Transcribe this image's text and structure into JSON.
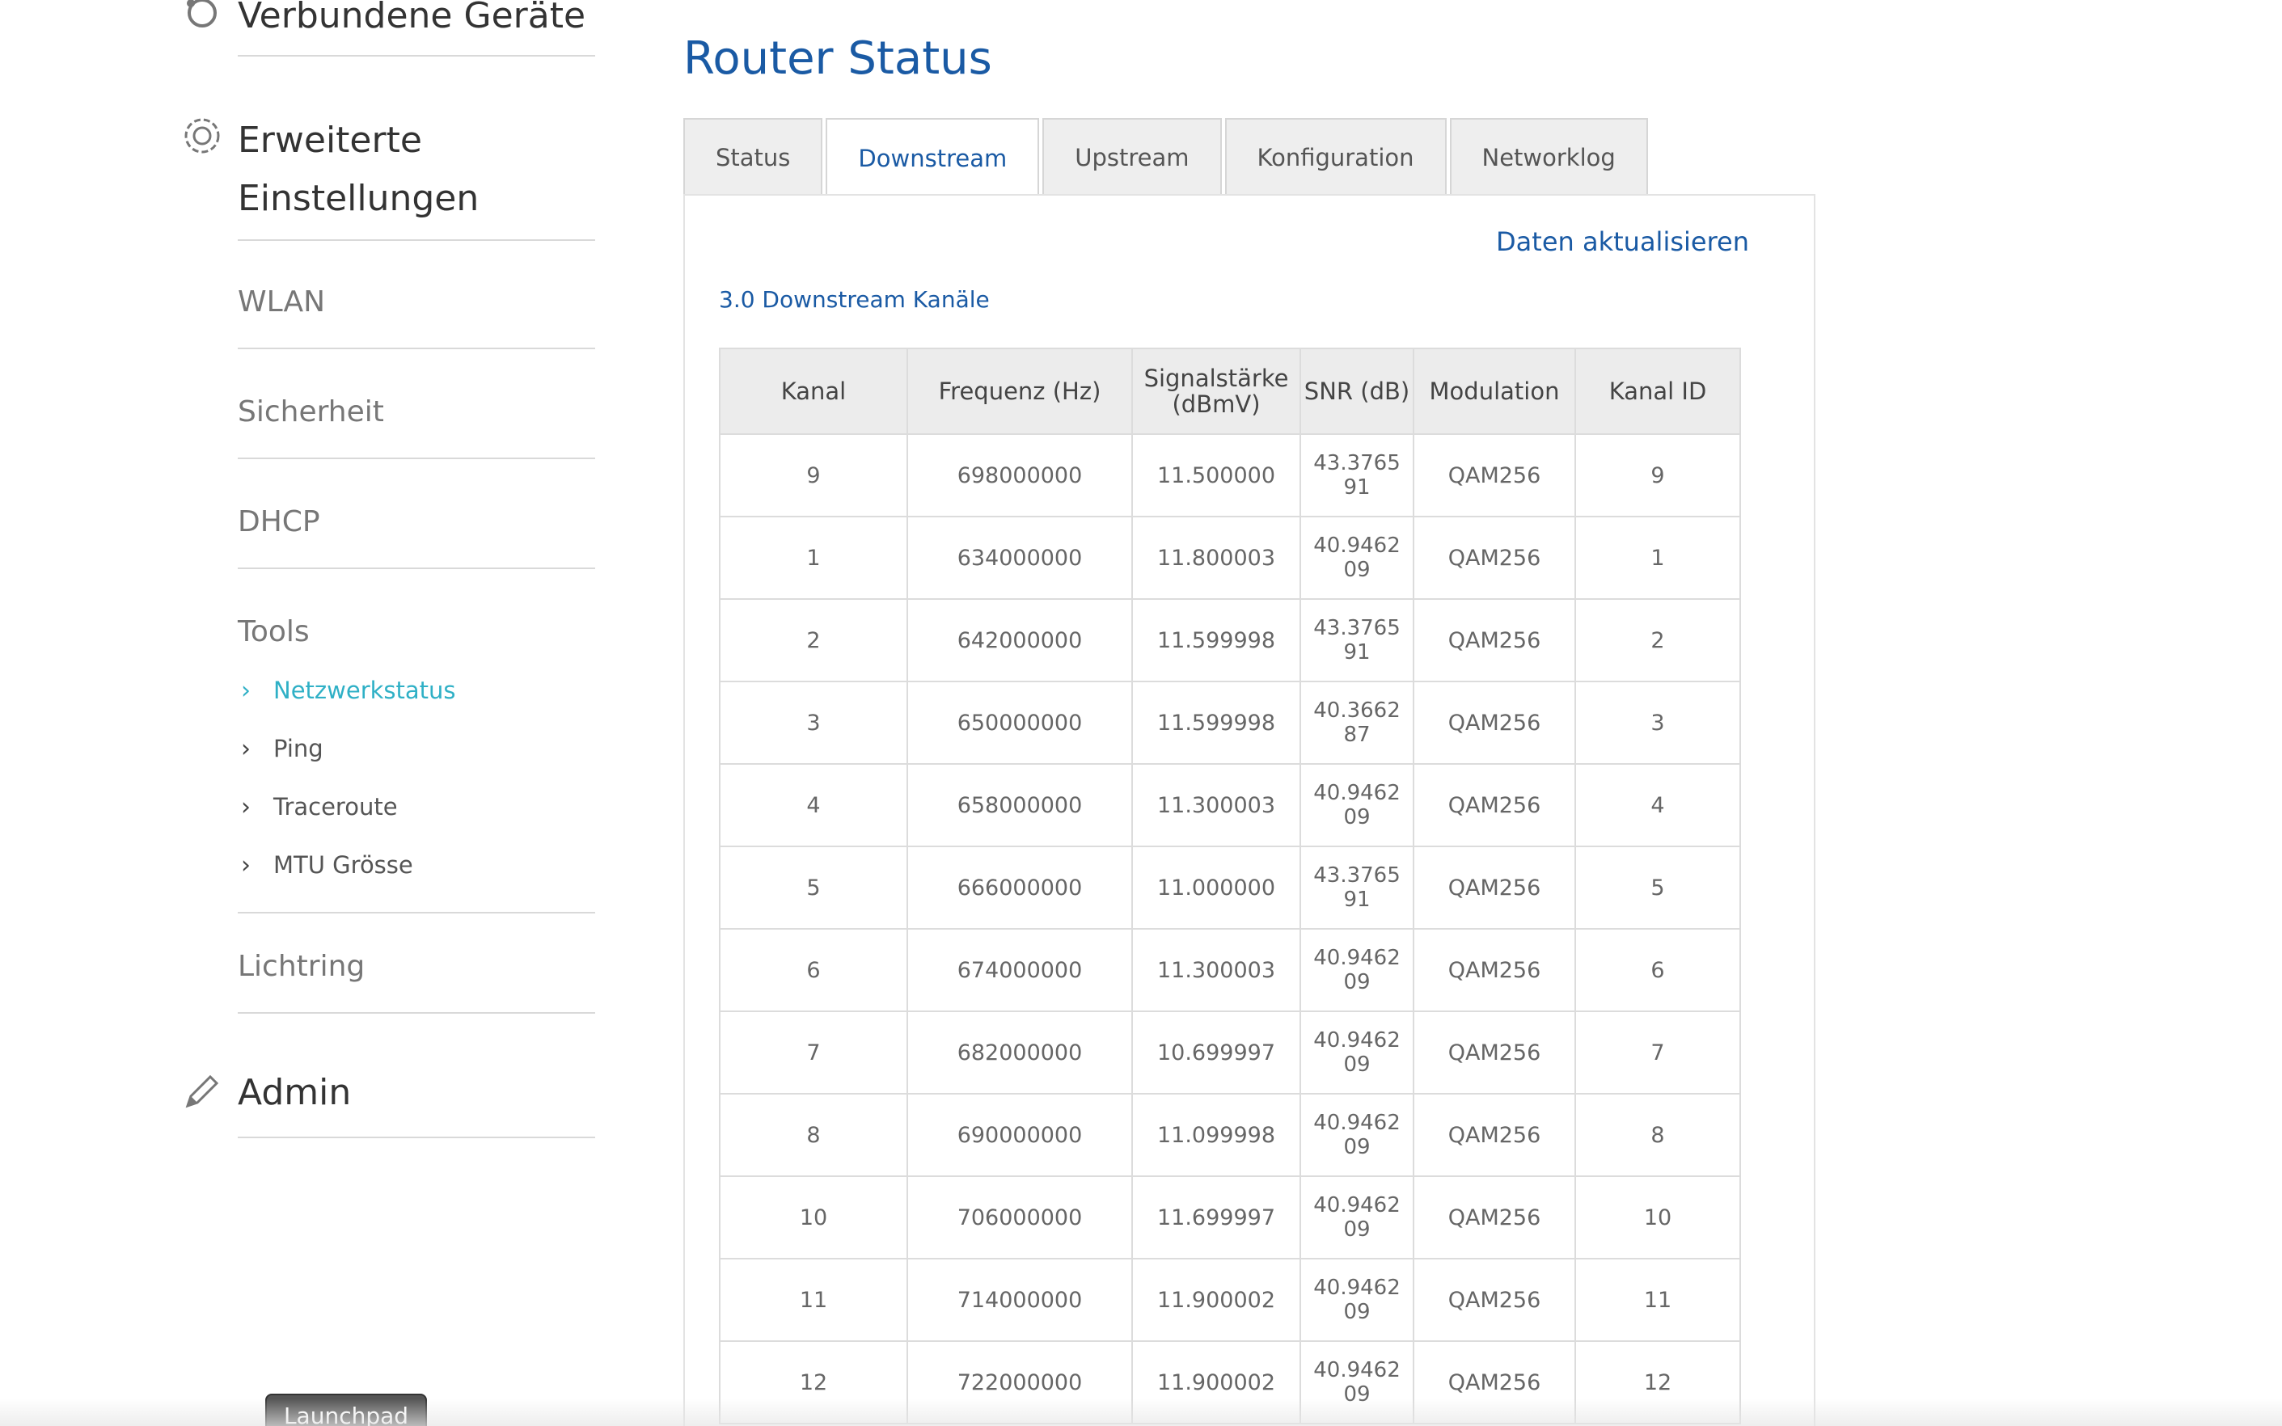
{
  "sidebar": {
    "connected_devices": "Verbundene Geräte",
    "advanced_line1": "Erweiterte",
    "advanced_line2": "Einstellungen",
    "items": [
      "WLAN",
      "Sicherheit",
      "DHCP",
      "Tools"
    ],
    "tools_sub": [
      "Netzwerkstatus",
      "Ping",
      "Traceroute",
      "MTU Grösse"
    ],
    "lichtring": "Lichtring",
    "admin": "Admin"
  },
  "main": {
    "title": "Router Status",
    "tabs": [
      "Status",
      "Downstream",
      "Upstream",
      "Konfiguration",
      "Networklog"
    ],
    "active_tab": "Downstream",
    "refresh": "Daten aktualisieren",
    "section_title": "3.0 Downstream Kanäle",
    "columns": [
      "Kanal",
      "Frequenz (Hz)",
      "Signalstärke (dBmV)",
      "SNR (dB)",
      "Modulation",
      "Kanal ID"
    ],
    "rows": [
      [
        "9",
        "698000000",
        "11.500000",
        "43.376591",
        "QAM256",
        "9"
      ],
      [
        "1",
        "634000000",
        "11.800003",
        "40.946209",
        "QAM256",
        "1"
      ],
      [
        "2",
        "642000000",
        "11.599998",
        "43.376591",
        "QAM256",
        "2"
      ],
      [
        "3",
        "650000000",
        "11.599998",
        "40.366287",
        "QAM256",
        "3"
      ],
      [
        "4",
        "658000000",
        "11.300003",
        "40.946209",
        "QAM256",
        "4"
      ],
      [
        "5",
        "666000000",
        "11.000000",
        "43.376591",
        "QAM256",
        "5"
      ],
      [
        "6",
        "674000000",
        "11.300003",
        "40.946209",
        "QAM256",
        "6"
      ],
      [
        "7",
        "682000000",
        "10.699997",
        "40.946209",
        "QAM256",
        "7"
      ],
      [
        "8",
        "690000000",
        "11.099998",
        "40.946209",
        "QAM256",
        "8"
      ],
      [
        "10",
        "706000000",
        "11.699997",
        "40.946209",
        "QAM256",
        "10"
      ],
      [
        "11",
        "714000000",
        "11.900002",
        "40.946209",
        "QAM256",
        "11"
      ],
      [
        "12",
        "722000000",
        "11.900002",
        "40.946209",
        "QAM256",
        "12"
      ]
    ]
  },
  "dock": {
    "launchpad": "Launchpad"
  },
  "colors": {
    "accent": "#1a5aa4",
    "active_sub": "#2fb0c6"
  }
}
